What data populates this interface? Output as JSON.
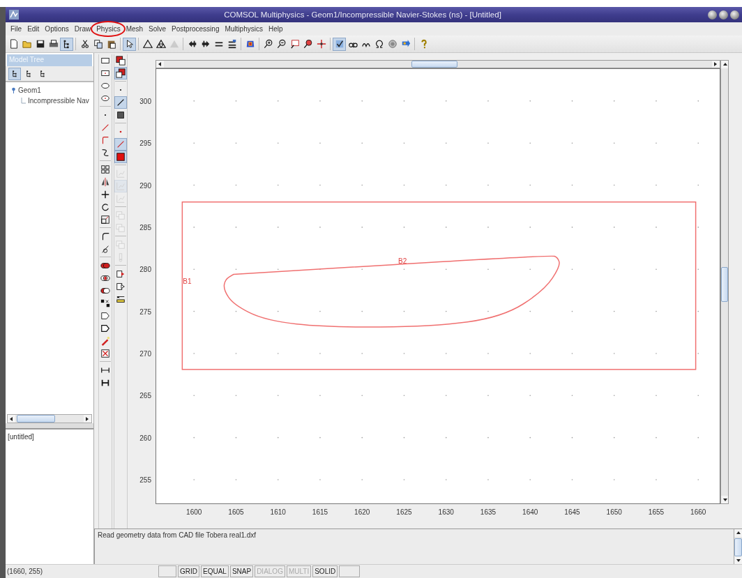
{
  "window": {
    "title": "COMSOL Multiphysics - Geom1/Incompressible Navier-Stokes (ns) - [Untitled]"
  },
  "menu": [
    {
      "label": "File",
      "circled": false
    },
    {
      "label": "Edit",
      "circled": false
    },
    {
      "label": "Options",
      "circled": false
    },
    {
      "label": "Draw",
      "circled": false
    },
    {
      "label": "Physics",
      "circled": true
    },
    {
      "label": "Mesh",
      "circled": false
    },
    {
      "label": "Solve",
      "circled": false
    },
    {
      "label": "Postprocessing",
      "circled": false
    },
    {
      "label": "Multiphysics",
      "circled": false
    },
    {
      "label": "Help",
      "circled": false
    }
  ],
  "toolbar": [
    [
      {
        "pressed": false,
        "disabled": false
      },
      {
        "pressed": false,
        "disabled": false
      },
      {
        "pressed": false,
        "disabled": false
      },
      {
        "pressed": false,
        "disabled": false
      },
      {
        "pressed": true,
        "disabled": false
      }
    ],
    [
      {
        "pressed": false,
        "disabled": false
      },
      {
        "pressed": false,
        "disabled": false
      },
      {
        "pressed": false,
        "disabled": false
      }
    ],
    [
      {
        "pressed": true,
        "disabled": false
      }
    ],
    [
      {
        "pressed": false,
        "disabled": false
      },
      {
        "pressed": false,
        "disabled": false
      },
      {
        "pressed": false,
        "disabled": true
      }
    ],
    [
      {
        "pressed": false,
        "disabled": false
      },
      {
        "pressed": false,
        "disabled": false
      },
      {
        "pressed": false,
        "disabled": false
      },
      {
        "pressed": false,
        "disabled": false
      }
    ],
    [
      {
        "pressed": false,
        "disabled": false
      }
    ],
    [
      {
        "pressed": false,
        "disabled": false
      },
      {
        "pressed": false,
        "disabled": false
      },
      {
        "pressed": false,
        "disabled": false
      },
      {
        "pressed": false,
        "disabled": false
      },
      {
        "pressed": false,
        "disabled": false
      }
    ],
    [
      {
        "pressed": true,
        "disabled": false
      },
      {
        "pressed": false,
        "disabled": false
      },
      {
        "pressed": false,
        "disabled": false
      },
      {
        "pressed": false,
        "disabled": false
      },
      {
        "pressed": false,
        "disabled": false
      },
      {
        "pressed": false,
        "disabled": false
      }
    ],
    [
      {
        "pressed": false,
        "disabled": false
      }
    ]
  ],
  "model_tree": {
    "title": "Model Tree",
    "view_buttons": [
      {
        "selected": true
      },
      {
        "selected": false
      },
      {
        "selected": false
      }
    ],
    "items": [
      {
        "label": "Geom1",
        "children": [
          {
            "label": "Incompressible Nav"
          }
        ]
      }
    ]
  },
  "lower_panel": {
    "text": "[untitled]"
  },
  "draw_tools": [
    [
      [
        {
          "pressed": false,
          "disabled": false
        },
        {
          "pressed": false,
          "disabled": false
        },
        {
          "pressed": false,
          "disabled": false
        },
        {
          "pressed": false,
          "disabled": false
        }
      ],
      [
        {
          "pressed": false,
          "disabled": false
        },
        {
          "pressed": false,
          "disabled": false
        },
        {
          "pressed": false,
          "disabled": false
        },
        {
          "pressed": false,
          "disabled": false
        }
      ],
      [
        {
          "pressed": false,
          "disabled": false
        },
        {
          "pressed": false,
          "disabled": false
        },
        {
          "pressed": false,
          "disabled": false
        },
        {
          "pressed": false,
          "disabled": false
        },
        {
          "pressed": false,
          "disabled": false
        }
      ],
      [
        {
          "pressed": false,
          "disabled": false
        },
        {
          "pressed": false,
          "disabled": false
        }
      ],
      [
        {
          "pressed": false,
          "disabled": false
        },
        {
          "pressed": false,
          "disabled": false
        },
        {
          "pressed": false,
          "disabled": false
        },
        {
          "pressed": false,
          "disabled": false
        },
        {
          "pressed": false,
          "disabled": false
        },
        {
          "pressed": false,
          "disabled": false
        },
        {
          "pressed": false,
          "disabled": false
        },
        {
          "pressed": false,
          "disabled": false
        }
      ],
      [
        {
          "pressed": false,
          "disabled": false
        },
        {
          "pressed": false,
          "disabled": false
        }
      ]
    ],
    [
      [
        {
          "pressed": false,
          "disabled": false
        },
        {
          "pressed": true,
          "disabled": false
        }
      ],
      [
        {
          "pressed": false,
          "disabled": false
        },
        {
          "pressed": true,
          "disabled": false
        },
        {
          "pressed": false,
          "disabled": false
        }
      ],
      [
        {
          "pressed": false,
          "disabled": false
        },
        {
          "pressed": true,
          "disabled": false
        },
        {
          "pressed": true,
          "disabled": false
        }
      ],
      [
        {
          "pressed": false,
          "disabled": true
        },
        {
          "pressed": true,
          "disabled": true
        },
        {
          "pressed": false,
          "disabled": true
        }
      ],
      [
        {
          "pressed": false,
          "disabled": true
        },
        {
          "pressed": false,
          "disabled": true
        }
      ],
      [
        {
          "pressed": false,
          "disabled": true
        },
        {
          "pressed": false,
          "disabled": true
        }
      ],
      [
        {
          "pressed": false,
          "disabled": false
        },
        {
          "pressed": false,
          "disabled": false
        },
        {
          "pressed": false,
          "disabled": false
        }
      ]
    ]
  ],
  "canvas": {
    "x_ticks": [
      "1600",
      "1605",
      "1610",
      "1615",
      "1620",
      "1625",
      "1630",
      "1635",
      "1640",
      "1645",
      "1650",
      "1655",
      "1660"
    ],
    "y_ticks": [
      "300",
      "295",
      "290",
      "285",
      "280",
      "275",
      "270",
      "265",
      "260",
      "255"
    ],
    "objects": [
      {
        "label": "B1",
        "kind": "rectangle"
      },
      {
        "label": "B2",
        "kind": "curve"
      }
    ]
  },
  "message": "Read geometry data from CAD file Tobera real1.dxf",
  "status_bar": {
    "coordinates": "(1660, 255)",
    "toggles": [
      {
        "label": "GRID",
        "enabled": true
      },
      {
        "label": "EQUAL",
        "enabled": true
      },
      {
        "label": "SNAP",
        "enabled": true
      },
      {
        "label": "DIALOG",
        "enabled": false
      },
      {
        "label": "MULTI",
        "enabled": false
      },
      {
        "label": "SOLID",
        "enabled": true
      }
    ]
  }
}
